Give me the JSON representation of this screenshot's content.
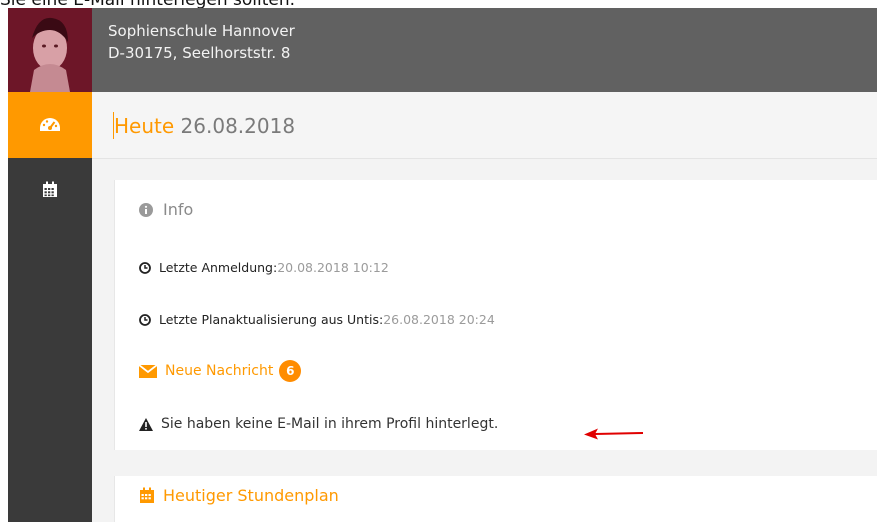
{
  "top_caption": "Sie eine E-Mail hinterlegen sollten.",
  "header": {
    "school_name": "Sophienschule Hannover",
    "address": "D-30175, Seelhorststr. 8"
  },
  "sidebar": {
    "items": [
      {
        "icon": "dashboard-icon",
        "active": true
      },
      {
        "icon": "calendar-icon",
        "active": false
      }
    ]
  },
  "page": {
    "title_prefix": "Heute",
    "title_date": "26.08.2018"
  },
  "info": {
    "heading": "Info",
    "last_login_label": "Letzte Anmeldung:",
    "last_login_value": "20.08.2018 10:12",
    "last_update_label": "Letzte Planaktualisierung aus Untis:",
    "last_update_value": "26.08.2018 20:24",
    "new_message_label": "Neue Nachricht",
    "new_message_count": "6",
    "warning_text": "Sie haben keine E-Mail in ihrem Profil hinterlegt."
  },
  "schedule": {
    "heading": "Heutiger Stundenplan"
  },
  "colors": {
    "accent": "#ff9900",
    "header_bg": "#616161",
    "sidebar_bg": "#3a3a3a",
    "arrow": "#e00000"
  }
}
